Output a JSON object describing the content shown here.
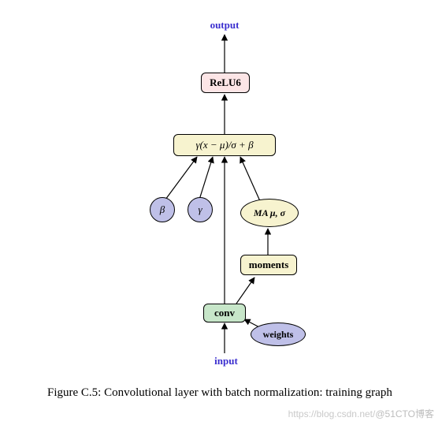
{
  "labels": {
    "output": "output",
    "input": "input"
  },
  "nodes": {
    "relu6": "ReLU6",
    "bn_formula": "γ(x − μ)/σ + β",
    "beta": "β",
    "gamma": "γ",
    "ma": "MA μ, σ",
    "moments": "moments",
    "conv": "conv",
    "weights": "weights"
  },
  "caption": "Figure C.5:  Convolutional layer with batch normalization: training graph",
  "watermark_left": "https://blog.csdn.net/",
  "watermark_right": "@51CTO博客",
  "colors": {
    "yellow": "#f7f3cf",
    "pink": "#fce5e6",
    "blue": "#bfc0e8",
    "green": "#c7e6c9",
    "label_blue": "#3b2fcf"
  }
}
